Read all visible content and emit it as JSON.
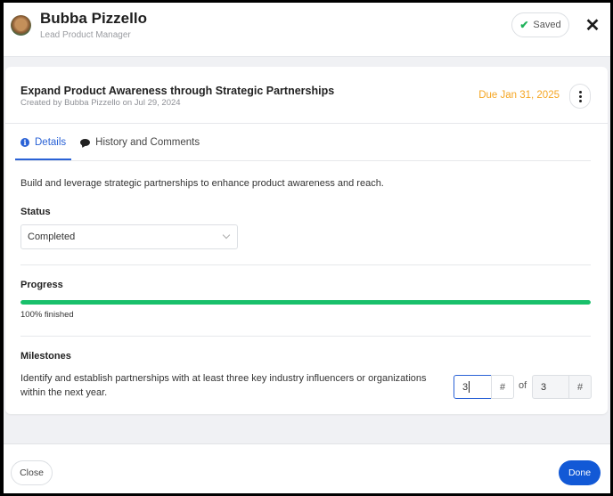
{
  "header": {
    "user_name": "Bubba Pizzello",
    "user_role": "Lead Product Manager",
    "saved_label": "Saved",
    "saved_icon": "check-icon",
    "close_icon": "close-icon",
    "close_glyph": "✕"
  },
  "goal": {
    "title": "Expand Product Awareness through Strategic Partnerships",
    "created_by": "Created by Bubba Pizzello on Jul 29, 2024",
    "due": "Due Jan 31, 2025",
    "due_color": "#f5a623",
    "menu_icon": "more-vertical-icon"
  },
  "tabs": [
    {
      "label": "Details",
      "icon": "info-icon",
      "active": true
    },
    {
      "label": "History and Comments",
      "icon": "comment-icon",
      "active": false
    }
  ],
  "details": {
    "description": "Build and leverage strategic partnerships to enhance product awareness and reach.",
    "status_label": "Status",
    "status_value": "Completed",
    "progress_label": "Progress",
    "progress_percent": 100,
    "progress_text": "100% finished",
    "progress_color": "#19c06b",
    "milestones_label": "Milestones",
    "milestones": [
      {
        "text": "Identify and establish partnerships with at least three key industry influencers or organizations within the next year.",
        "current_value": "3",
        "current_unit": "#",
        "of_label": "of",
        "target_value": "3",
        "target_unit": "#"
      }
    ]
  },
  "footer": {
    "close_label": "Close",
    "done_label": "Done",
    "done_color": "#1259d6"
  }
}
